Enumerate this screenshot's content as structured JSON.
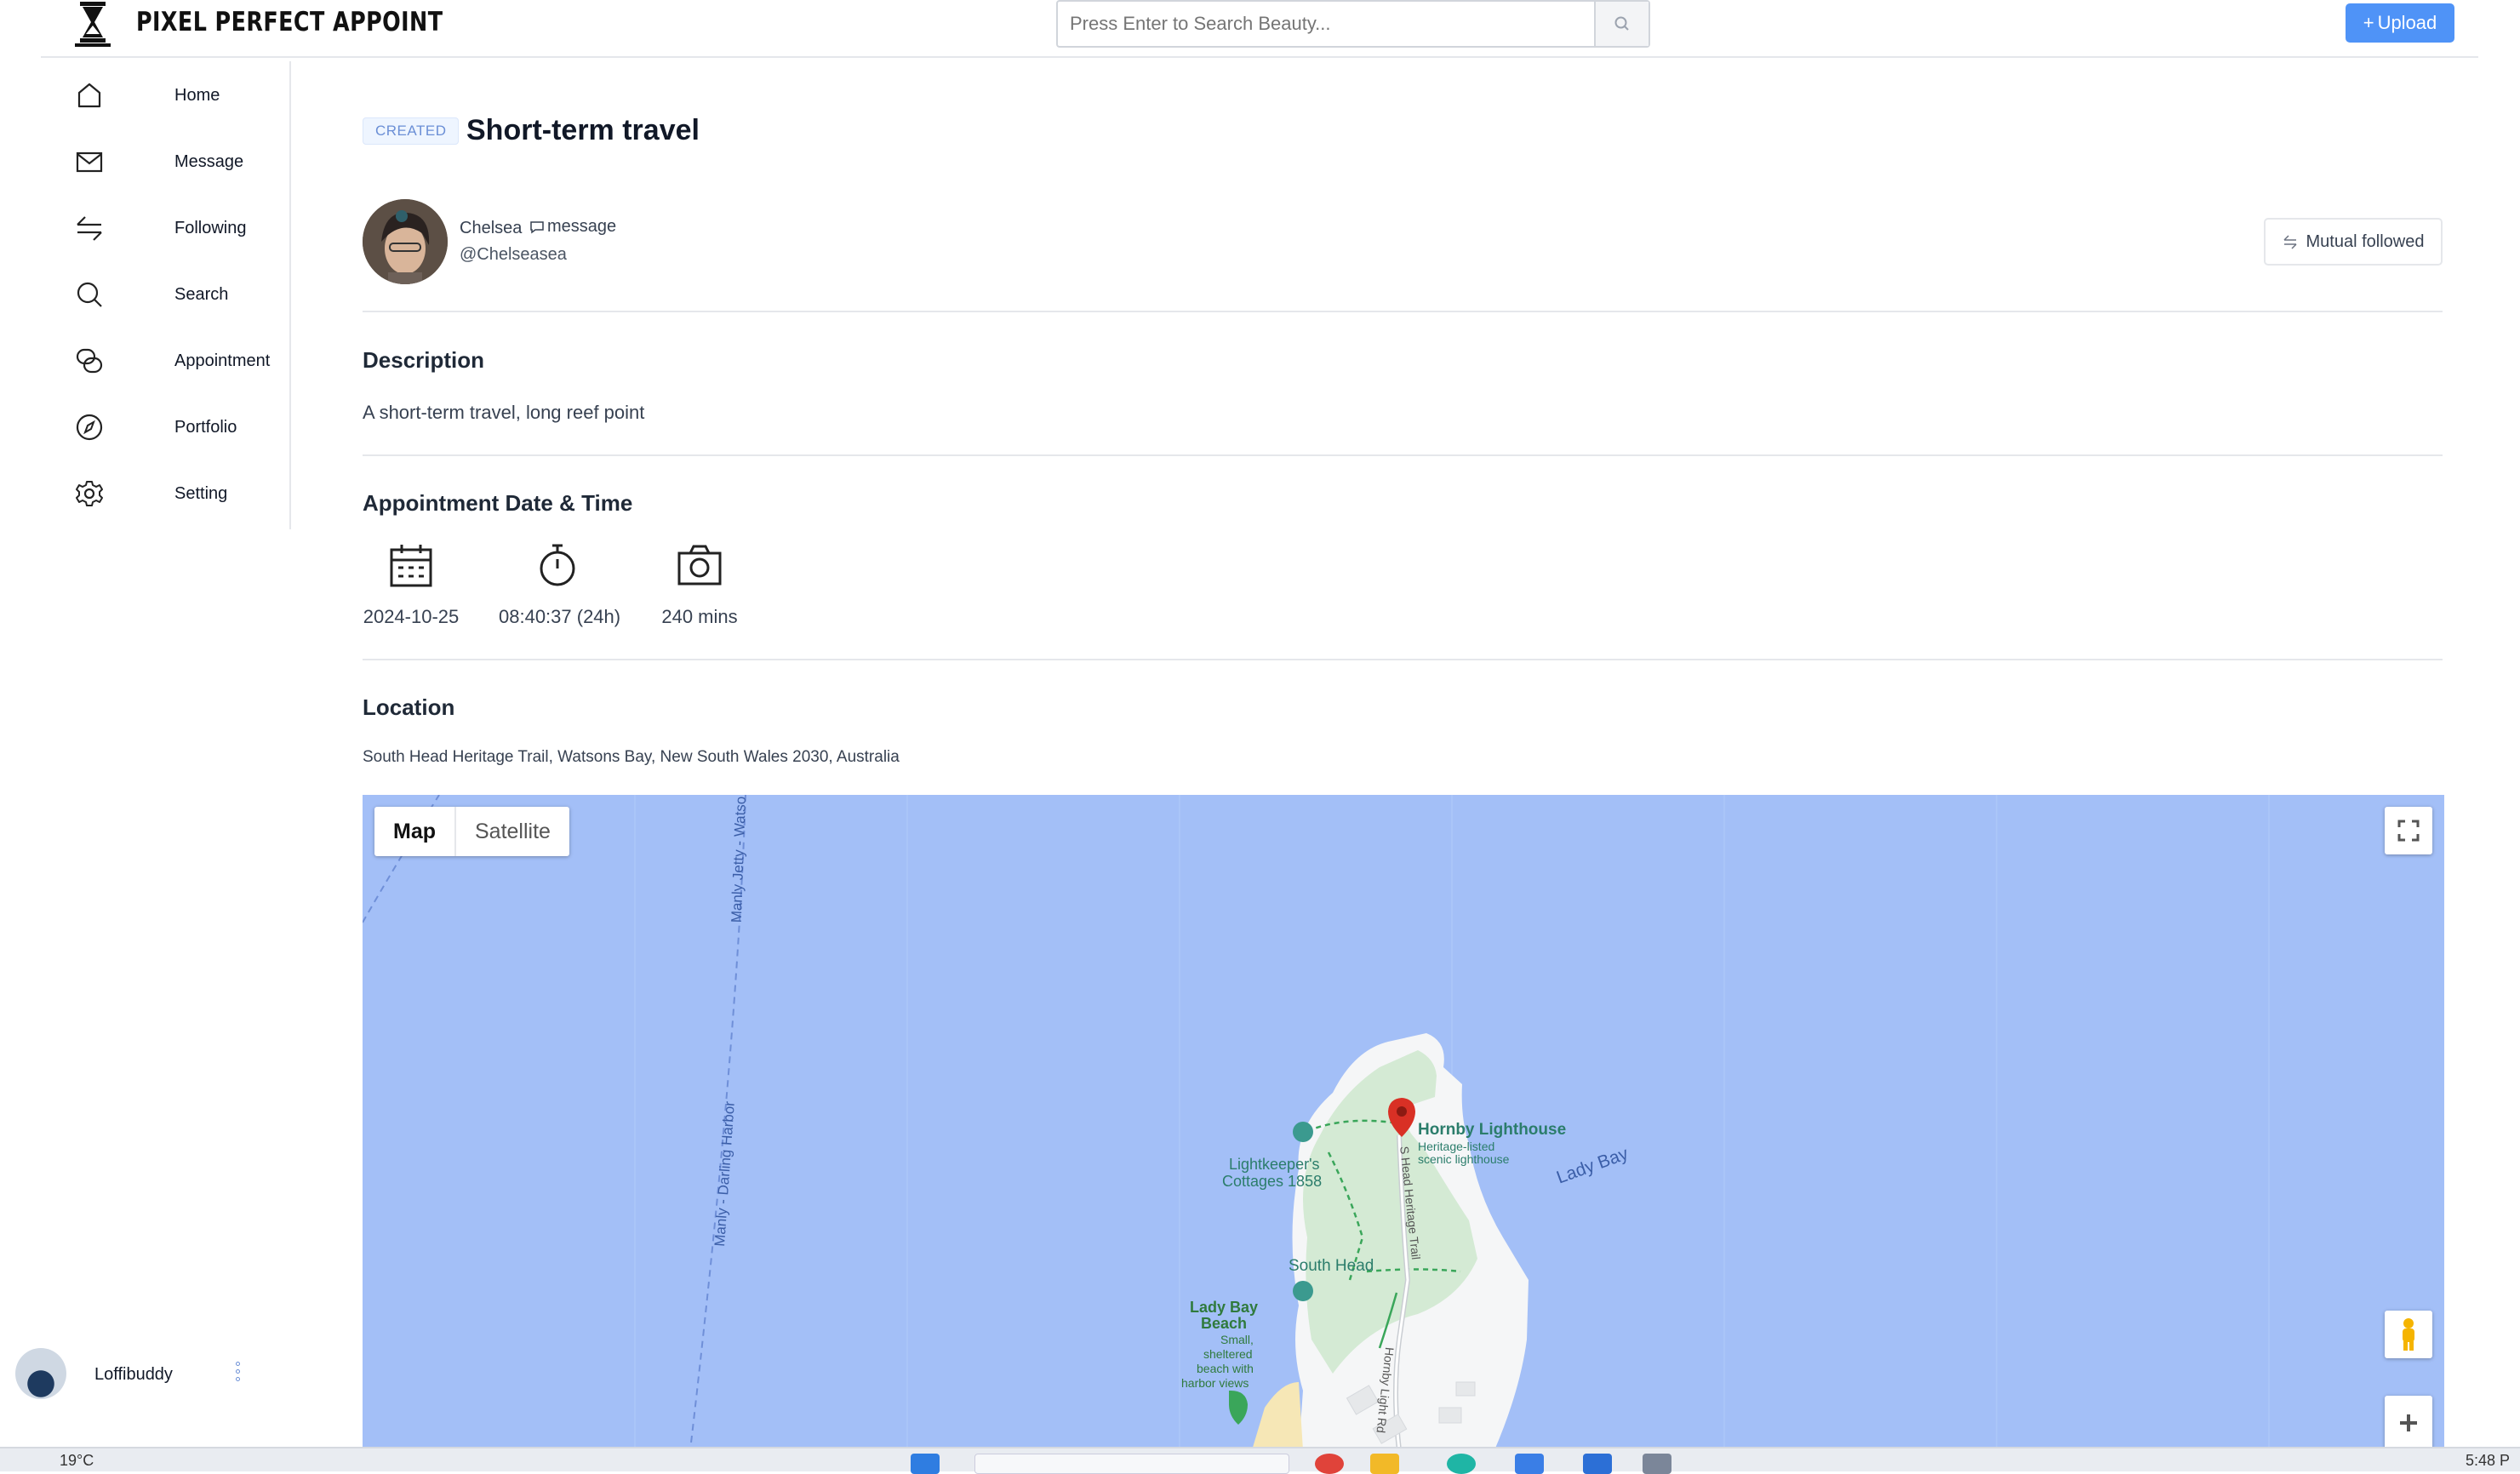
{
  "header": {
    "app_name": "PIXEL PERFECT APPOINT",
    "search_placeholder": "Press Enter to Search Beauty...",
    "upload_label": "Upload"
  },
  "sidebar": {
    "items": [
      {
        "label": "Home",
        "icon": "home-icon"
      },
      {
        "label": "Message",
        "icon": "mail-icon"
      },
      {
        "label": "Following",
        "icon": "following-icon"
      },
      {
        "label": "Search",
        "icon": "search-icon"
      },
      {
        "label": "Appointment",
        "icon": "chat-bubbles-icon"
      },
      {
        "label": "Portfolio",
        "icon": "compass-icon"
      },
      {
        "label": "Setting",
        "icon": "gear-icon"
      }
    ],
    "user": {
      "name": "Loffibuddy"
    }
  },
  "post": {
    "status_badge": "CREATED",
    "title": "Short-term travel",
    "author": {
      "name": "Chelsea",
      "message_label": "message",
      "handle": "@Chelseasea"
    },
    "follow_status": "Mutual followed"
  },
  "description": {
    "heading": "Description",
    "text": "A short-term travel, long reef point"
  },
  "appointment": {
    "heading": "Appointment Date & Time",
    "date": "2024-10-25",
    "time": "08:40:37 (24h)",
    "duration": "240 mins"
  },
  "location": {
    "heading": "Location",
    "address": "South Head Heritage Trail, Watsons Bay, New South Wales 2030, Australia"
  },
  "map": {
    "tabs": [
      "Map",
      "Satellite"
    ],
    "active_tab": "Map",
    "labels": {
      "ferry_1": "Manly Jetty - Watso",
      "ferry_2": "Manly - Darling Harbor",
      "lighthouse": "Hornby Lighthouse",
      "lighthouse_sub_1": "Heritage-listed",
      "lighthouse_sub_2": "scenic lighthouse",
      "cottages_1": "Lightkeeper's",
      "cottages_2": "Cottages 1858",
      "bay": "Lady Bay",
      "south_head": "South Head",
      "beach_1": "Lady Bay",
      "beach_2": "Beach",
      "beach_sub_1": "Small,",
      "beach_sub_2": "sheltered",
      "beach_sub_3": "beach with",
      "beach_sub_4": "harbor views",
      "trail": "S Head Heritage Trail",
      "road": "Hornby Light Rd"
    },
    "colors": {
      "water": "#a3bff7",
      "park": "#d4ead4",
      "land": "#f8f9fa",
      "marker": "#d93025"
    }
  },
  "taskbar": {
    "weather": "19°C",
    "time": "5:48 P"
  },
  "colors": {
    "accent": "#4f93f7",
    "badge_bg": "#eef5ff",
    "badge_text": "#6b8fd6"
  }
}
